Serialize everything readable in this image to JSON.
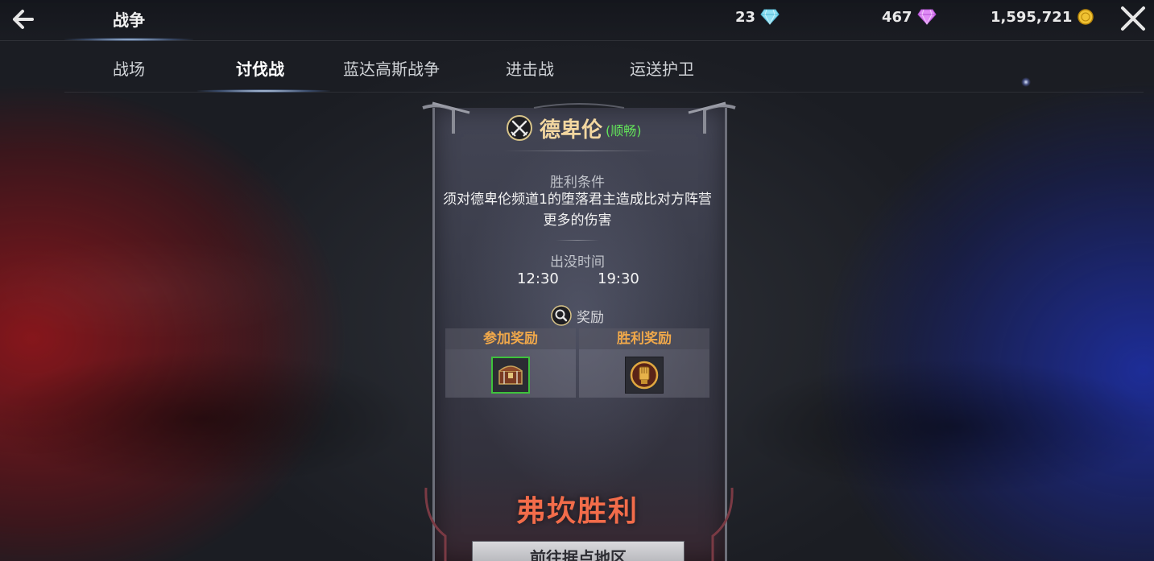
{
  "header": {
    "title": "战争",
    "back_icon": "back-arrow-icon",
    "close_icon": "close-icon"
  },
  "currencies": {
    "blue_diamond": {
      "value": "23",
      "icon": "blue-diamond-icon",
      "color": "#7fd3e8"
    },
    "purple_diamond": {
      "value": "467",
      "icon": "purple-diamond-icon",
      "color": "#d27cf0"
    },
    "gold": {
      "value": "1,595,721",
      "icon": "gold-coin-icon",
      "color": "#e8b73a"
    }
  },
  "tabs": [
    {
      "label": "战场",
      "active": false
    },
    {
      "label": "讨伐战",
      "active": true
    },
    {
      "label": "蓝达高斯战争",
      "active": false
    },
    {
      "label": "进击战",
      "active": false
    },
    {
      "label": "运送护卫",
      "active": false
    }
  ],
  "panel": {
    "icon": "crossed-swords-icon",
    "name": "德卑伦",
    "status": "(顺畅)",
    "status_color": "#63e35a",
    "victory_condition_label": "胜利条件",
    "victory_condition_text": "须对德卑伦频道1的堕落君主造成比对方阵营更多的伤害",
    "appear_time_label": "出没时间",
    "times": [
      "12:30",
      "19:30"
    ],
    "reward_label": "奖励",
    "reward_icon": "magnifier-icon",
    "participation_reward_label": "参加奖励",
    "participation_reward_item": "treasure-chest-icon",
    "victory_reward_label": "胜利奖励",
    "victory_reward_item": "golden-fist-emblem-icon",
    "result": "弗坎胜利",
    "result_color": "#f26c4a",
    "go_button": "前往据点地区"
  }
}
